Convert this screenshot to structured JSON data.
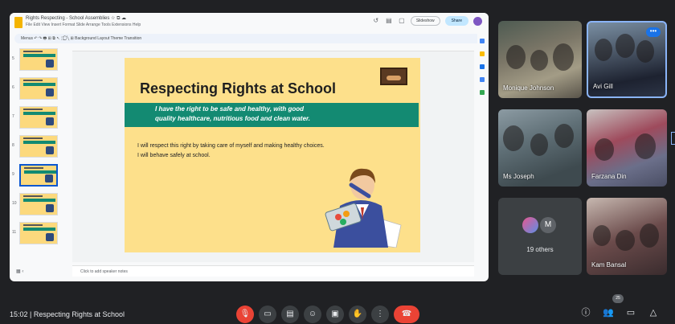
{
  "slides_app": {
    "doc_title": "Rights Respecting - School Assemblies  ☆  ⧉  ☁",
    "menu": "File  Edit  View  Insert  Format  Slide  Arrange  Tools  Extensions  Help",
    "slideshow_label": "Slideshow",
    "share_label": "Share",
    "toolbar_text": "Menus   ↶  ↷  🖶  ⊞  ⧉   ↖   ⬚  ⃝  ╲   ⊞   Background   Layout   Theme   Transition",
    "notes_placeholder": "Click to add speaker notes",
    "thumbnails": [
      {
        "num": "5"
      },
      {
        "num": "6"
      },
      {
        "num": "7"
      },
      {
        "num": "8"
      },
      {
        "num": "9"
      },
      {
        "num": "10"
      },
      {
        "num": "11"
      }
    ],
    "slide": {
      "title": "Respecting Rights at School",
      "banner_line1": "I have the right to be safe and healthy, with good",
      "banner_line2": "quality healthcare, nutritious food and clean water.",
      "body_line1": "I will respect this right by taking care of myself and making healthy choices.",
      "body_line2": "I will behave safely at school."
    }
  },
  "participants": [
    {
      "name": "Monique Johnson"
    },
    {
      "name": "Avi Gill"
    },
    {
      "name": "Ms Joseph"
    },
    {
      "name": "Farzana Din"
    },
    {
      "name": "Kam Bansal"
    }
  ],
  "others": {
    "initial": "M",
    "label": "19 others"
  },
  "meeting": {
    "time": "15:02",
    "separator": "|",
    "title": "Respecting Rights at School",
    "participant_count": "25"
  },
  "colors": {
    "slide_bg": "#fde08b",
    "banner": "#138a72",
    "end_call": "#ea4335",
    "meet_bg": "#202124"
  }
}
